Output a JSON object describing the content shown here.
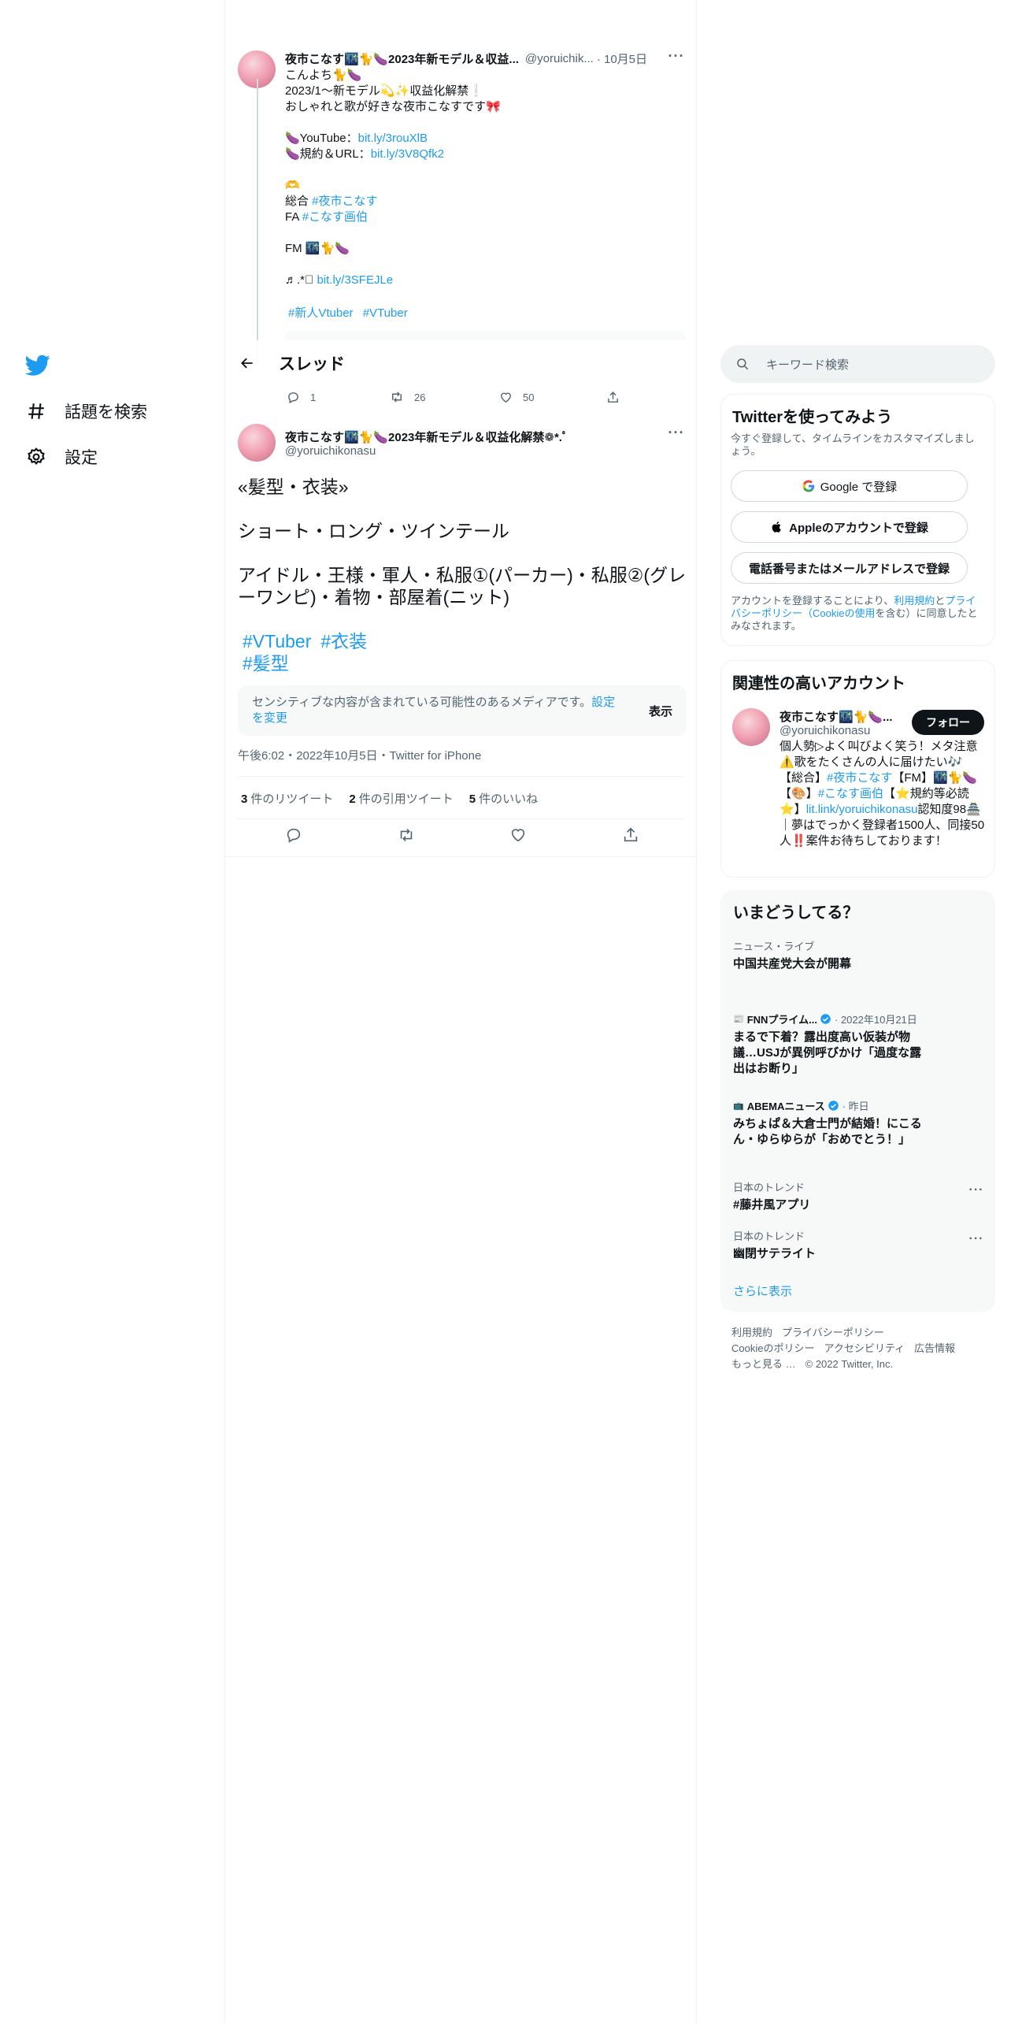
{
  "nav": {
    "logo": "twitter-bird-icon",
    "items": [
      {
        "label": "話題を検索",
        "icon": "hashtag-icon"
      },
      {
        "label": "設定",
        "icon": "gear-icon"
      }
    ]
  },
  "thread_header": {
    "title": "スレッド"
  },
  "parent_tweet": {
    "name": "夜市こなす🌃🐈🍆2023年新モデル＆収益...",
    "handle": "@yoruichik...",
    "date": "· 10月5日",
    "lines": [
      "こんよち🐈🍆",
      "2023/1～新モデル💫✨収益化解禁❕",
      "おしゃれと歌が好きな夜市こなすです🎀",
      "",
      "🍆YouTube：",
      "🍆規約＆URL：",
      "",
      "🫶",
      "総合 ",
      "FA ",
      "",
      "FM 🌃🐈🍆",
      "",
      "♬.*ﾟ"
    ],
    "links": {
      "youtube": "bit.ly/3rouXlB",
      "terms": "bit.ly/3V8Qfk2",
      "general_tag": "#夜市こなす",
      "fa_tag": "#こなす画伯",
      "music": "bit.ly/3SFEJLe"
    },
    "tags": [
      "#新人Vtuber",
      "#VTuber"
    ],
    "replies": "1",
    "retweets": "26",
    "likes": "50"
  },
  "main_tweet": {
    "name": "夜市こなす🌃🐈🍆2023年新モデル＆収益化解禁❁*.ﾟ",
    "handle": "@yoruichikonasu",
    "text": [
      "«髪型・衣装»",
      "ショート・ロング・ツインテール",
      "アイドル・王様・軍人・私服①(パーカー)・私服②(グレーワンピ)・着物・部屋着(ニット)"
    ],
    "tags": [
      "#VTuber",
      "#衣装",
      "#髪型"
    ],
    "sensitive": {
      "text": "センシティブな内容が含まれている可能性のあるメディアです。",
      "link": "設定を変更",
      "show": "表示"
    },
    "meta": "午後6:02・2022年10月5日・Twitter for iPhone",
    "stats": [
      {
        "count": "3",
        "label": "件のリツイート"
      },
      {
        "count": "2",
        "label": "件の引用ツイート"
      },
      {
        "count": "5",
        "label": "件のいいね"
      }
    ]
  },
  "search": {
    "placeholder": "キーワード検索"
  },
  "signup": {
    "title": "Twitterを使ってみよう",
    "subtitle": "今すぐ登録して、タイムラインをカスタマイズしましょう。",
    "google": "Google で登録",
    "apple": "Appleのアカウントで登録",
    "phone": "電話番号またはメールアドレスで登録",
    "legal_1": "アカウントを登録することにより、",
    "legal_terms": "利用規約",
    "legal_and": "と",
    "legal_privacy": "プライバシーポリシー（Cookieの使用",
    "legal_2": "を含む）に同意したとみなされます。"
  },
  "related": {
    "title": "関連性の高いアカウント",
    "name": "夜市こなす🌃🐈🍆...",
    "handle": "@yoruichikonasu",
    "follow": "フォロー",
    "bio_1": "個人勢▷よく叫びよく笑う！メタ注意⚠️歌をたくさんの人に届けたい🎶【総合】",
    "bio_tag1": "#夜市こなす",
    "bio_2": "【FM】🌃🐈🍆【🎨】",
    "bio_tag2": "#こなす画伯",
    "bio_3": "【⭐️規約等必読⭐️】",
    "bio_link": "lit.link/yoruichikonasu",
    "bio_4": "認知度98🏯｜夢はでっかく登録者1500人、同接50人‼️案件お待ちしております！"
  },
  "trends": {
    "title": "いまどうしてる？",
    "items": [
      {
        "category": "ニュース・ライブ",
        "title": "中国共産党大会が開幕"
      },
      {
        "source": "FNNプライム...",
        "date": "· 2022年10月21日",
        "title": "まるで下着？露出度高い仮装が物議…USJが異例呼びかけ「過度な露出はお断り」"
      },
      {
        "source": "ABEMAニュース",
        "date": "· 昨日",
        "title": "みちょぱ＆大倉士門が結婚！にこるん・ゆらゆらが「おめでとう！」"
      },
      {
        "category": "日本のトレンド",
        "title": "#藤井風アプリ"
      },
      {
        "category": "日本のトレンド",
        "title": "幽閉サテライト"
      }
    ],
    "show_more": "さらに表示"
  },
  "footer": {
    "links": [
      "利用規約",
      "プライバシーポリシー",
      "Cookieのポリシー",
      "アクセシビリティ",
      "広告情報",
      "もっと見る …"
    ],
    "copyright": "© 2022 Twitter, Inc."
  },
  "colors": {
    "accent": "#1d9bf0",
    "text": "#0f1419",
    "muted": "#536471"
  }
}
